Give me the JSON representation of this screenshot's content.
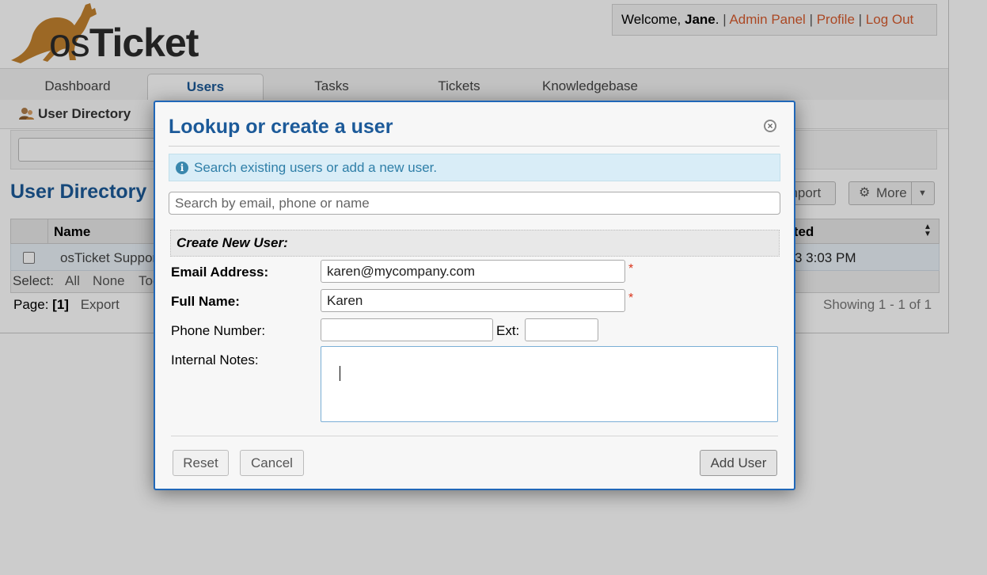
{
  "header": {
    "logo_text_os": "os",
    "logo_text_ticket": "Ticket",
    "welcome_prefix": "Welcome, ",
    "user_name": "Jane",
    "welcome_suffix": ".",
    "separator": "|",
    "links": [
      "Admin Panel",
      "Profile",
      "Log Out"
    ]
  },
  "nav": {
    "tabs": [
      "Dashboard",
      "Users",
      "Tasks",
      "Tickets",
      "Knowledgebase"
    ],
    "active": "Users"
  },
  "subnav": {
    "item": "User Directory",
    "icon": "users-icon"
  },
  "main": {
    "title": "User Directory",
    "import_label": "Import",
    "more_label": "More",
    "table": {
      "headers": [
        "Name",
        "Created"
      ],
      "rows": [
        {
          "name": "osTicket Support",
          "created": "3 3:03 PM"
        }
      ],
      "select_label": "Select:",
      "select_options": [
        "All",
        "None",
        "Toggle"
      ]
    },
    "pagination": {
      "page_label": "Page:",
      "current_page": "[1]",
      "export": "Export",
      "showing": "Showing 1 - 1 of 1"
    }
  },
  "dialog": {
    "title": "Lookup or create a user",
    "close_icon": "close-icon",
    "info": "Search existing users or add a new user.",
    "search_placeholder": "Search by email, phone or name",
    "create_heading": "Create New User:",
    "fields": {
      "email_label": "Email Address:",
      "email_value": "karen@mycompany.com",
      "fullname_label": "Full Name:",
      "fullname_value": "Karen",
      "phone_label": "Phone Number:",
      "phone_value": "",
      "ext_label": "Ext:",
      "ext_value": "",
      "notes_label": "Internal Notes:",
      "required_mark": "*"
    },
    "buttons": {
      "reset": "Reset",
      "cancel": "Cancel",
      "add_user": "Add User"
    }
  },
  "colors": {
    "brand_blue": "#1c5a99",
    "link_orange": "#d65b2e",
    "dialog_border": "#2067b8",
    "info_bg": "#d9edf7",
    "required": "#d9341b"
  }
}
